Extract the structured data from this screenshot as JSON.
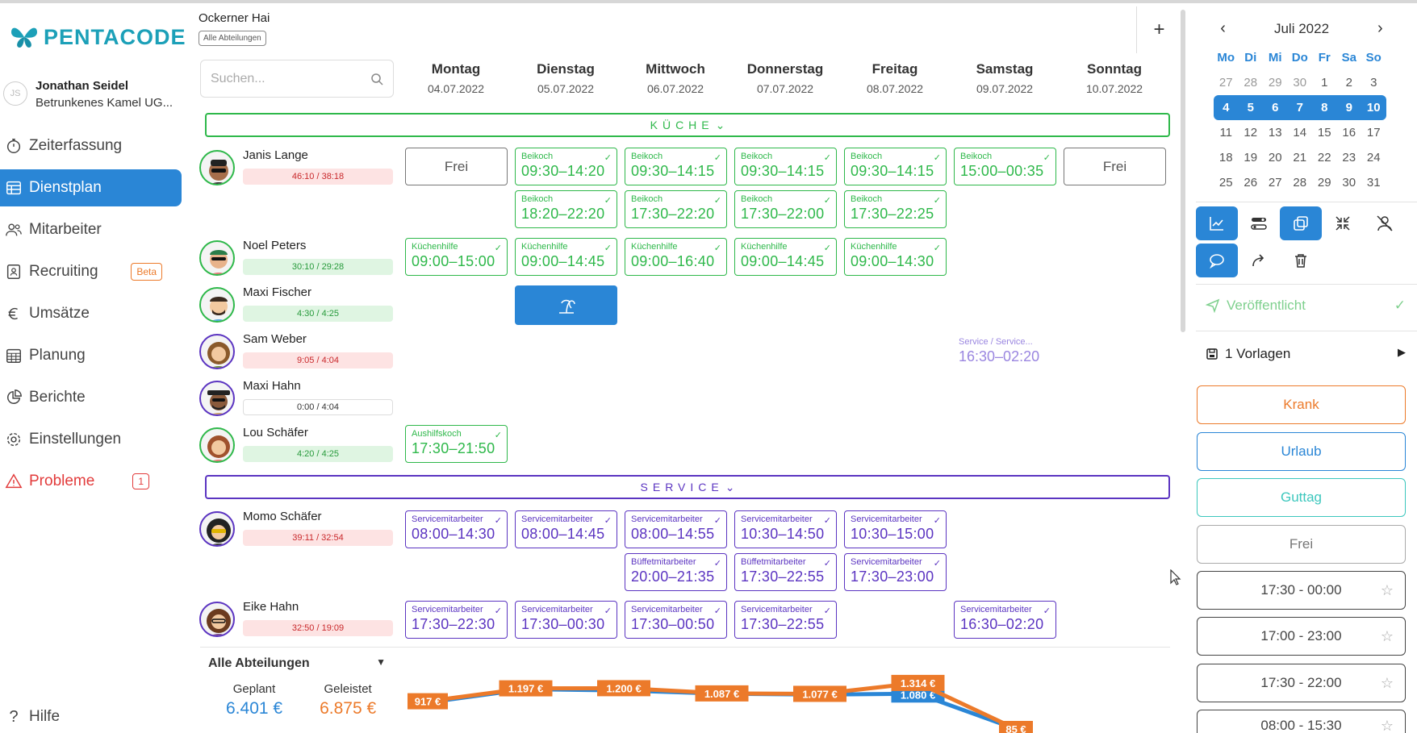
{
  "app": {
    "logo_text": "PENTACODE"
  },
  "user": {
    "initials": "JS",
    "name": "Jonathan Seidel",
    "company": "Betrunkenes Kamel UG..."
  },
  "nav": [
    {
      "label": "Zeiterfassung",
      "icon": "stopwatch-icon"
    },
    {
      "label": "Dienstplan",
      "icon": "table-icon",
      "active": true
    },
    {
      "label": "Mitarbeiter",
      "icon": "people-icon"
    },
    {
      "label": "Recruiting",
      "icon": "id-card-icon",
      "badge": "Beta"
    },
    {
      "label": "Umsätze",
      "icon": "euro-icon"
    },
    {
      "label": "Planung",
      "icon": "calendar-grid-icon"
    },
    {
      "label": "Berichte",
      "icon": "pie-chart-icon"
    },
    {
      "label": "Einstellungen",
      "icon": "gear-icon"
    },
    {
      "label": "Probleme",
      "icon": "warning-icon",
      "badge": "1"
    }
  ],
  "help_label": "Hilfe",
  "header": {
    "title": "Ockerner Hai",
    "dept_pill": "Alle Abteilungen",
    "add_label": "+"
  },
  "search": {
    "placeholder": "Suchen..."
  },
  "days": [
    {
      "name": "Montag",
      "date": "04.07.2022"
    },
    {
      "name": "Dienstag",
      "date": "05.07.2022"
    },
    {
      "name": "Mittwoch",
      "date": "06.07.2022"
    },
    {
      "name": "Donnerstag",
      "date": "07.07.2022"
    },
    {
      "name": "Freitag",
      "date": "08.07.2022"
    },
    {
      "name": "Samstag",
      "date": "09.07.2022"
    },
    {
      "name": "Sonntag",
      "date": "10.07.2022"
    }
  ],
  "sections": {
    "kueche": "KÜCHE",
    "service": "SERVICE"
  },
  "employees": [
    {
      "name": "Janis Lange",
      "hours": "46:10 / 38:18"
    },
    {
      "name": "Noel Peters",
      "hours": "30:10 / 29:28"
    },
    {
      "name": "Maxi Fischer",
      "hours": "4:30 / 4:25"
    },
    {
      "name": "Sam Weber",
      "hours": "9:05 / 4:04"
    },
    {
      "name": "Maxi Hahn",
      "hours": "0:00 / 4:04"
    },
    {
      "name": "Lou Schäfer",
      "hours": "4:20 / 4:25"
    },
    {
      "name": "Momo Schäfer",
      "hours": "39:11 / 32:54"
    },
    {
      "name": "Eike Hahn",
      "hours": "32:50 / 19:09"
    }
  ],
  "free_label": "Frei",
  "shifts": {
    "janis": [
      {
        "role": "Beikoch",
        "time": "09:30–14:20"
      },
      {
        "role": "Beikoch",
        "time": "09:30–14:15"
      },
      {
        "role": "Beikoch",
        "time": "09:30–14:15"
      },
      {
        "role": "Beikoch",
        "time": "09:30–14:15"
      },
      {
        "role": "Beikoch",
        "time": "15:00–00:35"
      },
      {
        "role": "Beikoch",
        "time": "18:20–22:20"
      },
      {
        "role": "Beikoch",
        "time": "17:30–22:20"
      },
      {
        "role": "Beikoch",
        "time": "17:30–22:00"
      },
      {
        "role": "Beikoch",
        "time": "17:30–22:25"
      }
    ],
    "noel": [
      {
        "role": "Küchenhilfe",
        "time": "09:00–15:00"
      },
      {
        "role": "Küchenhilfe",
        "time": "09:00–14:45"
      },
      {
        "role": "Küchenhilfe",
        "time": "09:00–16:40"
      },
      {
        "role": "Küchenhilfe",
        "time": "09:00–14:45"
      },
      {
        "role": "Küchenhilfe",
        "time": "09:00–14:30"
      }
    ],
    "sam_ghost": {
      "role": "Service / Service...",
      "time": "16:30–02:20"
    },
    "lou": {
      "role": "Aushilfskoch",
      "time": "17:30–21:50"
    },
    "momo": [
      {
        "role": "Servicemitarbeiter",
        "time": "08:00–14:30"
      },
      {
        "role": "Servicemitarbeiter",
        "time": "08:00–14:45"
      },
      {
        "role": "Servicemitarbeiter",
        "time": "08:00–14:55"
      },
      {
        "role": "Servicemitarbeiter",
        "time": "10:30–14:50"
      },
      {
        "role": "Servicemitarbeiter",
        "time": "10:30–15:00"
      },
      {
        "role": "Büffetmitarbeiter",
        "time": "20:00–21:35"
      },
      {
        "role": "Büffetmitarbeiter",
        "time": "17:30–22:55"
      },
      {
        "role": "Servicemitarbeiter",
        "time": "17:30–23:00"
      }
    ],
    "eike": [
      {
        "role": "Servicemitarbeiter",
        "time": "17:30–22:30"
      },
      {
        "role": "Servicemitarbeiter",
        "time": "17:30–00:30"
      },
      {
        "role": "Servicemitarbeiter",
        "time": "17:30–00:50"
      },
      {
        "role": "Servicemitarbeiter",
        "time": "17:30–22:55"
      },
      {
        "role": "Servicemitarbeiter",
        "time": "16:30–02:20"
      }
    ]
  },
  "summary": {
    "dept_select": "Alle Abteilungen",
    "geplant_label": "Geplant",
    "geplant_value": "6.401 €",
    "geleistet_label": "Geleistet",
    "geleistet_value": "6.875 €"
  },
  "chart_data": {
    "type": "line",
    "categories": [
      "Montag",
      "Dienstag",
      "Mittwoch",
      "Donnerstag",
      "Freitag",
      "Samstag",
      "Sonntag"
    ],
    "series": [
      {
        "name": "Geleistet",
        "color": "#ec7a2a",
        "values": [
          917,
          1197,
          1200,
          1087,
          1077,
          1314,
          85
        ],
        "labels": [
          "917 €",
          "1.197 €",
          "1.200 €",
          "1.087 €",
          "1.077 €",
          "1.314 €",
          "85 €"
        ]
      },
      {
        "name": "Geplant",
        "color": "#2a86d6",
        "values": [
          890,
          1180,
          1150,
          1080,
          1060,
          1080,
          60
        ],
        "labels": [
          "",
          "",
          "",
          "",
          "",
          "1.080 €",
          ""
        ]
      }
    ]
  },
  "calendar": {
    "month": "Juli 2022",
    "weekdays": [
      "Mo",
      "Di",
      "Mi",
      "Do",
      "Fr",
      "Sa",
      "So"
    ],
    "weeks": [
      [
        "27",
        "28",
        "29",
        "30",
        "1",
        "2",
        "3"
      ],
      [
        "4",
        "5",
        "6",
        "7",
        "8",
        "9",
        "10"
      ],
      [
        "11",
        "12",
        "13",
        "14",
        "15",
        "16",
        "17"
      ],
      [
        "18",
        "19",
        "20",
        "21",
        "22",
        "23",
        "24"
      ],
      [
        "25",
        "26",
        "27",
        "28",
        "29",
        "30",
        "31"
      ]
    ],
    "selected_week_index": 1
  },
  "right": {
    "published_label": "Veröffentlicht",
    "templates_label": "1 Vorlagen",
    "krank": "Krank",
    "urlaub": "Urlaub",
    "guttag": "Guttag",
    "frei": "Frei",
    "templates": [
      "17:30 - 00:00",
      "17:00 - 23:00",
      "17:30 - 22:00",
      "08:00 - 15:30"
    ]
  },
  "colors": {
    "primary": "#2a86d6",
    "kueche": "#2eb84a",
    "service": "#5b34c1",
    "orange": "#ec7a2a",
    "teal": "#1ca0b8"
  }
}
